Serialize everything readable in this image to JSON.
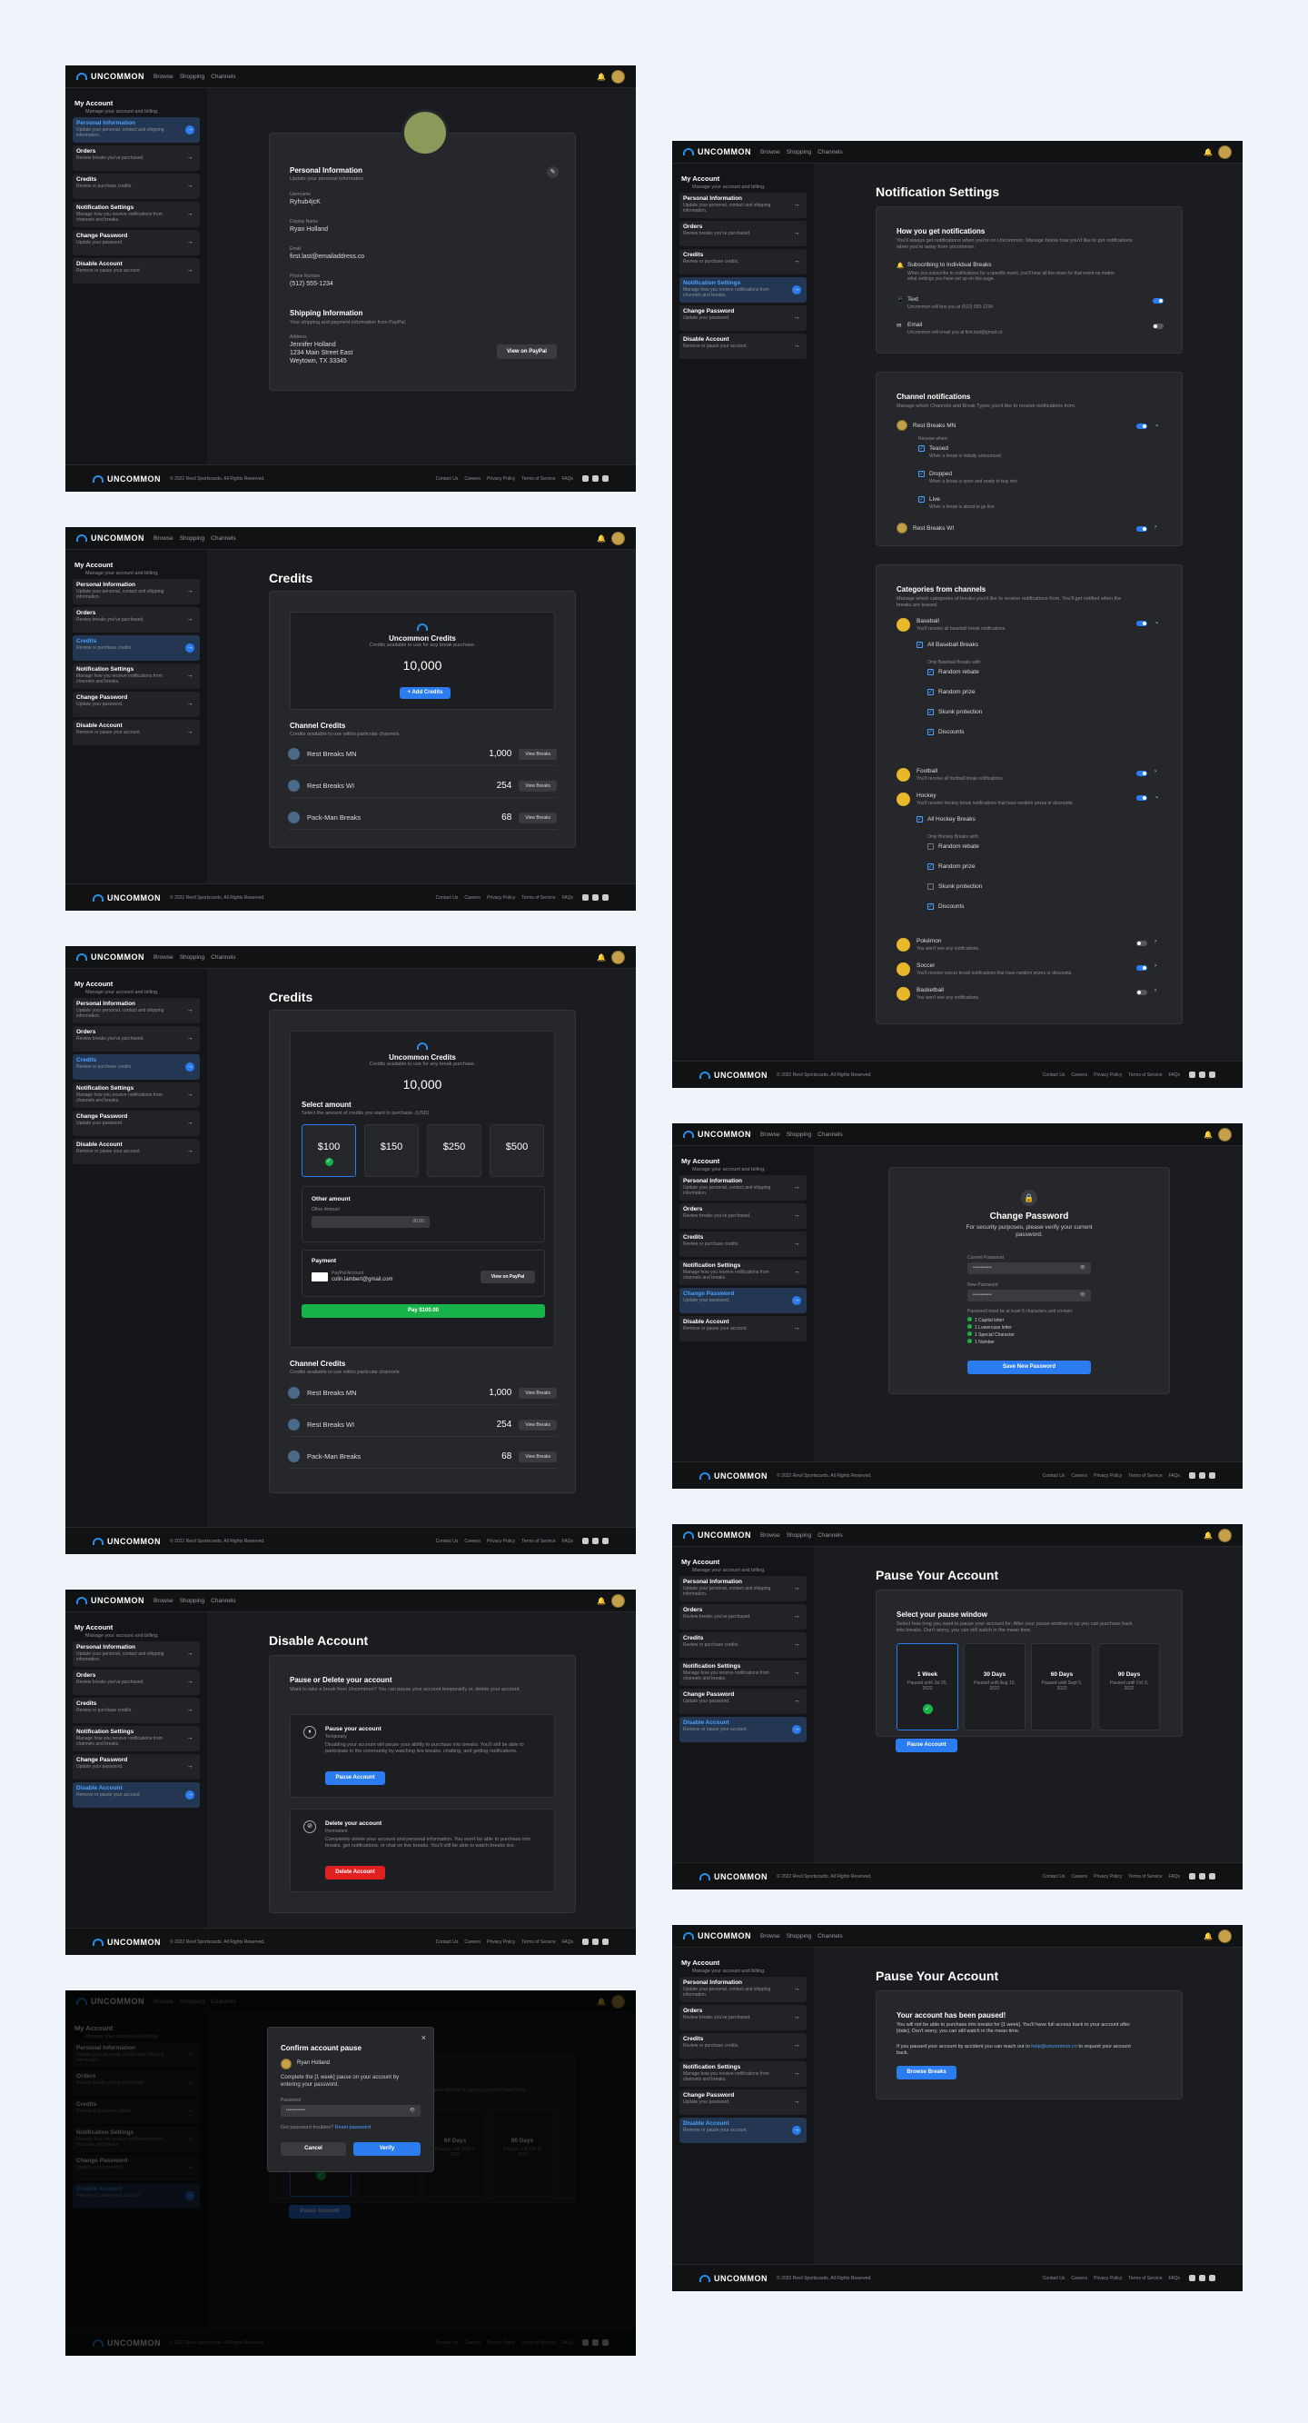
{
  "app": {
    "brand": "UNCOMMON",
    "nav": [
      "Browse",
      "Shopping",
      "Channels"
    ],
    "footer_copy": "© 2022 Revil Sportscards. All Rights Reserved.",
    "footer_links": [
      "Contact Us",
      "Careers",
      "Privacy Policy",
      "Terms of Service",
      "FAQs"
    ]
  },
  "menu": {
    "title": "My Account",
    "subtitle": "Manage your account and billing.",
    "items": [
      {
        "label": "Personal Information",
        "desc": "Update your personal, contact and shipping information."
      },
      {
        "label": "Orders",
        "desc": "Review breaks you've purchased."
      },
      {
        "label": "Credits",
        "desc": "Review or purchase credits."
      },
      {
        "label": "Notification Settings",
        "desc": "Manage how you receive notifications from channels and breaks."
      },
      {
        "label": "Change Password",
        "desc": "Update your password."
      },
      {
        "label": "Disable Account",
        "desc": "Remove or pause your account."
      }
    ]
  },
  "personal": {
    "title": "Personal Information",
    "subtitle": "Update your personal information",
    "username_label": "Username",
    "username": "Ryhub4jcK",
    "name_label": "Display Name",
    "name": "Ryan Holland",
    "email_label": "Email",
    "email": "first.last@emailaddress.co",
    "phone_label": "Phone Number",
    "phone": "(512) 555-1234",
    "ship_title": "Shipping Information",
    "ship_sub": "Your shipping and payment information from PayPal.",
    "addr_label": "Address",
    "addr1": "Jennifer Holland",
    "addr2": "1234 Main Street East",
    "addr3": "Weytown, TX 33345",
    "paypal_btn": "View on PayPal"
  },
  "credits": {
    "page_title": "Credits",
    "box_title": "Uncommon Credits",
    "box_sub": "Credits available to use for any break purchase.",
    "amount": "10,000",
    "add_btn": "+ Add Credits",
    "ch_title": "Channel Credits",
    "ch_sub": "Credits available to use within particular channels",
    "channels": [
      {
        "name": "Rest Breaks MN",
        "value": "1,000"
      },
      {
        "name": "Rest Breaks WI",
        "value": "254"
      },
      {
        "name": "Pack-Man Breaks",
        "value": "68"
      }
    ],
    "view_btn": "View Breaks",
    "select_title": "Select amount",
    "select_sub": "Select the amount of credits you want to purchase. (USD)",
    "options": [
      "$100",
      "$150",
      "$250",
      "$500"
    ],
    "other_title": "Other amount",
    "other_label": "Other Amount",
    "other_ph": "00.00",
    "pay_title": "Payment",
    "pay_acct": "PayPal Account",
    "pay_email": "colin.lambert@gmail.com",
    "pay_view": "View on PayPal",
    "pay_btn": "Pay $100.00"
  },
  "notif": {
    "page_title": "Notification Settings",
    "how_title": "How you get notifications",
    "how_sub": "You'll always get notifications when you're on Uncommon; Manage below how you'd like to get notifications when you're away from uncommon.",
    "subs_label": "Subscribing to Individual Breaks",
    "subs_desc": "When you subscribe to notifications for a specific event, you'll hear all the news for that event no matter what settings you have set up on this page.",
    "text_label": "Text",
    "text_desc": "Uncommon will text you at (512) 555-1234",
    "email_label": "Email",
    "email_desc": "Uncommon will email you at first.last@gmail.co",
    "ch_title": "Channel notifications",
    "ch_sub": "Manage which Channels and Break Types you'd like to receive notifications from.",
    "ch1": "Rest Breaks MN",
    "ch2": "Rest Breaks WI",
    "rec": "Receive when:",
    "teased": "Teased",
    "teased_d": "When a break is initially announced.",
    "dropped": "Dropped",
    "dropped_d": "When a break is open and ready to buy into.",
    "live": "Live",
    "live_d": "When a break is about to go live.",
    "cat_title": "Categories from channels",
    "cat_sub": "Manage which categories of breaks you'd like to receive notifications from. You'll get notified when the breaks are teased.",
    "baseball": "Baseball",
    "baseball_d": "You'll receive all baseball break notifications.",
    "all_base": "All Baseball Breaks",
    "only_base": "Only Baseball Breaks with:",
    "opts": [
      "Random rebate",
      "Random prize",
      "Skunk protection",
      "Discounts"
    ],
    "football": "Football",
    "football_d": "You'll receive all football break notifications.",
    "hockey": "Hockey",
    "hockey_d": "You'll receive hockey break notifications that have random prizes or discounts.",
    "all_hockey": "All Hockey Breaks",
    "only_hockey": "Only Hockey Breaks with:",
    "pokemon": "Pokémon",
    "pokemon_d": "You won't see any notifications.",
    "soccer": "Soccer",
    "soccer_d": "You'll receive soccer break notifications that have random prizes or discounts.",
    "basketball": "Basketball",
    "basketball_d": "You won't see any notifications."
  },
  "password": {
    "title": "Change Password",
    "sub": "For security purposes, please verify your current password.",
    "cur": "Current Password",
    "new": "New Password",
    "rules_title": "Password must be at least 8 characters and contain:",
    "rules": [
      "1 Capital letter",
      "1 Lowercase letter",
      "1 Special Character",
      "1 Number"
    ],
    "btn": "Save New Password",
    "mask": "••••••••••••"
  },
  "disable": {
    "page_title": "Disable Account",
    "card_title": "Pause or Delete your account",
    "card_sub": "Want to take a break from Uncommon? You can pause your account temporarily or, delete your account.",
    "pause_title": "Pause your account",
    "pause_tag": "Temporary",
    "pause_desc": "Disabling your account will pause your ability to purchase into breaks. You'll still be able to participate in the community by watching live breaks, chatting, and getting notifications.",
    "pause_btn": "Pause Account",
    "del_title": "Delete your account",
    "del_tag": "Permanent",
    "del_desc": "Completely delete your account and personal information. You won't be able to purchase into breaks, get notifications, or chat on live breaks. You'll still be able to watch breaks live.",
    "del_btn": "Delete Account"
  },
  "pause": {
    "page_title": "Pause Your Account",
    "sel_title": "Select your pause window",
    "sel_sub": "Select how long you want to pause your account for. After your pause window is up you can purchase back into breaks. Don't worry, you can still watch in the mean time.",
    "opts": [
      {
        "t": "1 Week",
        "d": "Paused until Jul 26, 2022"
      },
      {
        "t": "30 Days",
        "d": "Paused until Aug 19, 2022"
      },
      {
        "t": "60 Days",
        "d": "Paused until Sept 5, 2022"
      },
      {
        "t": "90 Days",
        "d": "Paused until Oct 9, 2022"
      }
    ],
    "btn": "Pause Account",
    "done_title": "Your account has been paused!",
    "done_1": "You will not be able to purchase into breaks for [1 week]. You'll have full access back to your account after [date]. Don't worry, you can still watch in the mean time.",
    "done_2": "If you paused your account by accident you can reach out to",
    "done_link": "help@uncommon.co",
    "done_3": "to request your account back.",
    "done_btn": "Browse Breaks"
  },
  "modal": {
    "title": "Confirm account pause",
    "user": "Ryan Holland",
    "text": "Complete the [1 week] pause on your account by entering your password.",
    "pw_label": "Password",
    "forgot": "Got password troubles?",
    "reset": "Reset password",
    "cancel": "Cancel",
    "verify": "Verify"
  }
}
